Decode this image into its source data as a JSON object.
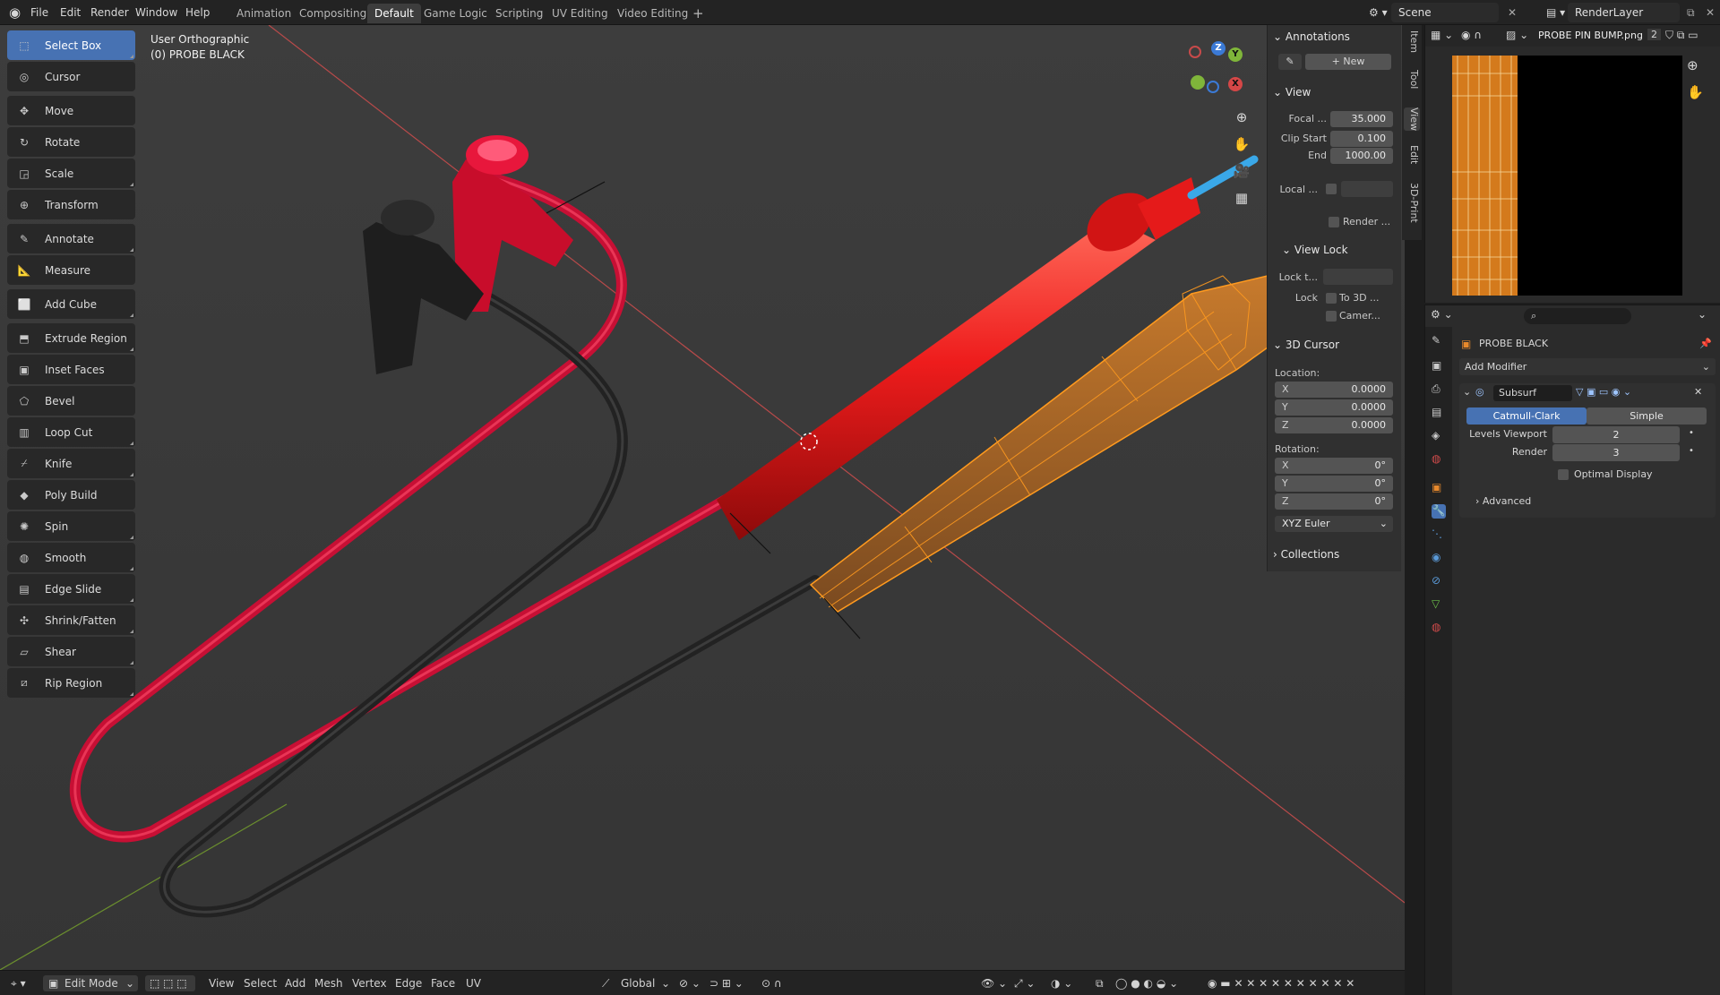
{
  "topbar": {
    "menus": [
      "File",
      "Edit",
      "Render",
      "Window",
      "Help"
    ],
    "workspaces": [
      "Animation",
      "Compositing",
      "Default",
      "Game Logic",
      "Scripting",
      "UV Editing",
      "Video Editing"
    ],
    "active_workspace": "Default",
    "add_tab": "+",
    "scene": "Scene",
    "view_layer": "RenderLayer"
  },
  "viewport": {
    "view_name": "User Orthographic",
    "object_name": "(0) PROBE BLACK"
  },
  "toolbar": [
    {
      "label": "Select Box",
      "icon": "select-box-icon",
      "active": true
    },
    {
      "label": "Cursor",
      "icon": "cursor-icon"
    },
    {
      "label": "Move",
      "icon": "move-icon"
    },
    {
      "label": "Rotate",
      "icon": "rotate-icon"
    },
    {
      "label": "Scale",
      "icon": "scale-icon"
    },
    {
      "label": "Transform",
      "icon": "transform-icon"
    },
    {
      "label": "Annotate",
      "icon": "annotate-icon"
    },
    {
      "label": "Measure",
      "icon": "measure-icon"
    },
    {
      "label": "Add Cube",
      "icon": "add-cube-icon"
    },
    {
      "label": "Extrude Region",
      "icon": "extrude-icon"
    },
    {
      "label": "Inset Faces",
      "icon": "inset-icon"
    },
    {
      "label": "Bevel",
      "icon": "bevel-icon"
    },
    {
      "label": "Loop Cut",
      "icon": "loop-cut-icon"
    },
    {
      "label": "Knife",
      "icon": "knife-icon"
    },
    {
      "label": "Poly Build",
      "icon": "poly-build-icon"
    },
    {
      "label": "Spin",
      "icon": "spin-icon"
    },
    {
      "label": "Smooth",
      "icon": "smooth-icon"
    },
    {
      "label": "Edge Slide",
      "icon": "edge-slide-icon"
    },
    {
      "label": "Shrink/Fatten",
      "icon": "shrink-fatten-icon"
    },
    {
      "label": "Shear",
      "icon": "shear-icon"
    },
    {
      "label": "Rip Region",
      "icon": "rip-region-icon"
    }
  ],
  "gizmo": {
    "x": "X",
    "y": "Y",
    "z": "Z"
  },
  "npanel": {
    "annotations_title": "Annotations",
    "new_label": "New",
    "view_title": "View",
    "focal_label": "Focal ...",
    "focal_value": "35.000",
    "clip_start_label": "Clip Start",
    "clip_start_value": "0.100",
    "end_label": "End",
    "end_value": "1000.00",
    "local_label": "Local ...",
    "render_label": "Render ...",
    "view_lock_title": "View Lock",
    "lock_t_label": "Lock t...",
    "lock_label": "Lock",
    "to3d_label": "To 3D ...",
    "camera_label": "Camer...",
    "cursor_title": "3D Cursor",
    "location_label": "Location:",
    "loc_x": "0.0000",
    "loc_y": "0.0000",
    "loc_z": "0.0000",
    "rotation_label": "Rotation:",
    "rot_x": "0°",
    "rot_y": "0°",
    "rot_z": "0°",
    "rotation_mode": "XYZ Euler",
    "collections_title": "Collections",
    "axis_x": "X",
    "axis_y": "Y",
    "axis_z": "Z"
  },
  "ntabs": [
    "Item",
    "Tool",
    "View",
    "Edit",
    "3D-Print"
  ],
  "bottombar": {
    "mode": "Edit Mode",
    "menus": [
      "View",
      "Select",
      "Add",
      "Mesh",
      "Vertex",
      "Edge",
      "Face",
      "UV"
    ],
    "orientation": "Global"
  },
  "image_editor": {
    "image_name": "PROBE PIN BUMP.png",
    "users": "2"
  },
  "properties": {
    "object_name": "PROBE BLACK",
    "add_modifier": "Add Modifier",
    "modifier_name": "Subsurf",
    "catmull_clark": "Catmull-Clark",
    "simple": "Simple",
    "levels_viewport_label": "Levels Viewport",
    "levels_viewport_value": "2",
    "render_label": "Render",
    "render_value": "3",
    "optimal_display": "Optimal Display",
    "advanced": "Advanced"
  },
  "colors": {
    "accent": "#4772b3",
    "probe_red": "#e8191c",
    "selection_orange": "#ff9a1f",
    "cable_red": "#d8123a",
    "cable_black": "#2a2a2a"
  }
}
